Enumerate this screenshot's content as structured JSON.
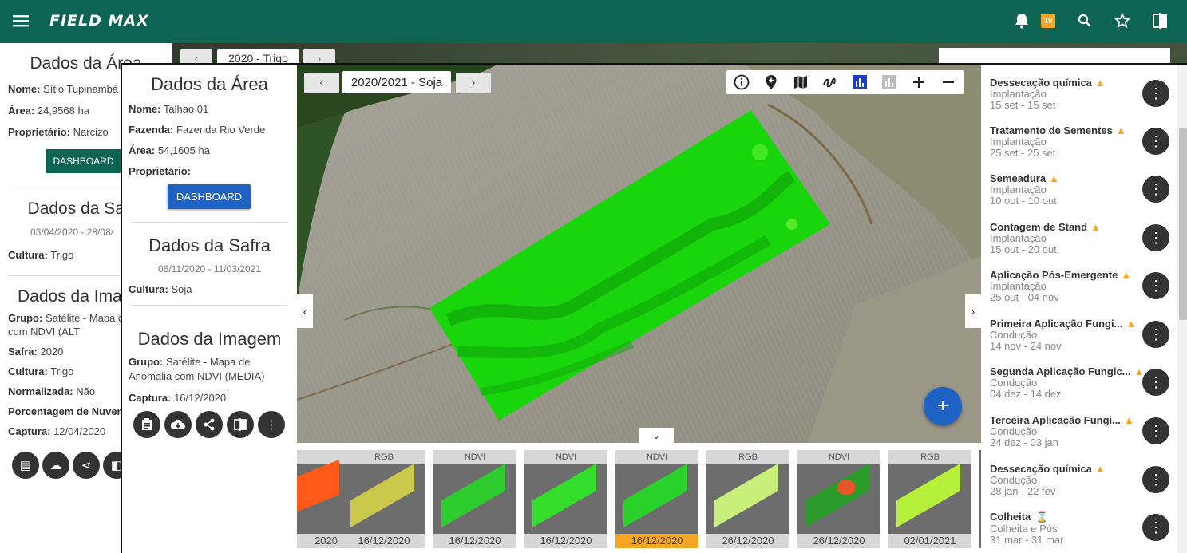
{
  "app": {
    "brand": "FIELD MAX",
    "notifications_count": "19"
  },
  "back_window": {
    "area": {
      "title": "Dados da Área",
      "nome_label": "Nome:",
      "nome": "Sítio Tupinambá",
      "area_label": "Área:",
      "area": "24,9568 ha",
      "proprietario_label": "Proprietário:",
      "proprietario": "Narcizo",
      "dashboard": "DASHBOARD"
    },
    "safra": {
      "title": "Dados da Safra",
      "dates": "03/04/2020 - 28/08/",
      "cultura_label": "Cultura:",
      "cultura": "Trigo"
    },
    "imagem": {
      "title": "Dados da Imagem",
      "grupo_label": "Grupo:",
      "grupo": "Satélite - Mapa d Anomalia com NDVI (ALT",
      "safra_label": "Safra:",
      "safra": "2020",
      "cultura_label": "Cultura:",
      "cultura": "Trigo",
      "normalizada_label": "Normalizada:",
      "normalizada": "Não",
      "porcentagem_label": "Porcentagem de Nuvem",
      "captura_label": "Captura:",
      "captura": "12/04/2020"
    },
    "season": "2020 - Trigo"
  },
  "front_window": {
    "area": {
      "title": "Dados da Área",
      "nome_label": "Nome:",
      "nome": "Talhao 01",
      "fazenda_label": "Fazenda:",
      "fazenda": "Fazenda Rio Verde",
      "area_label": "Área:",
      "area": "54,1605 ha",
      "proprietario_label": "Proprietário:",
      "dashboard": "DASHBOARD"
    },
    "safra": {
      "title": "Dados da Safra",
      "dates": "06/11/2020 - 11/03/2021",
      "cultura_label": "Cultura:",
      "cultura": "Soja"
    },
    "imagem": {
      "title": "Dados da Imagem",
      "grupo_label": "Grupo:",
      "grupo": "Satélite - Mapa de Anomalia com NDVI (MEDIA)",
      "captura_label": "Captura:",
      "captura": "16/12/2020"
    },
    "season": "2020/2021 - Soja",
    "thumbnails": [
      {
        "type": "",
        "date": "2020",
        "color": "#ff5a1a"
      },
      {
        "type": "RGB",
        "date": "16/12/2020",
        "color": "#c9c84a"
      },
      {
        "type": "NDVI",
        "date": "16/12/2020",
        "color": "#2ecb2e"
      },
      {
        "type": "NDVI",
        "date": "16/12/2020",
        "color": "#33dd2a"
      },
      {
        "type": "NDVI",
        "date": "16/12/2020",
        "color": "#2bd12b"
      },
      {
        "type": "RGB",
        "date": "26/12/2020",
        "color": "#c7ef7a"
      },
      {
        "type": "NDVI",
        "date": "26/12/2020",
        "color": "#2a9a2a"
      },
      {
        "type": "RGB",
        "date": "02/01/2021",
        "color": "#b7f03a"
      }
    ],
    "tasks": [
      {
        "title": "Dessecação química",
        "phase": "Implantação",
        "range": "15 set - 15 set",
        "icon": "warning"
      },
      {
        "title": "Tratamento de Sementes",
        "phase": "Implantação",
        "range": "25 set - 25 set",
        "icon": "warning"
      },
      {
        "title": "Semeadura",
        "phase": "Implantação",
        "range": "10 out - 10 out",
        "icon": "warning"
      },
      {
        "title": "Contagem de Stand",
        "phase": "Implantação",
        "range": "15 out - 20 out",
        "icon": "warning"
      },
      {
        "title": "Aplicação Pós-Emergente",
        "phase": "Implantação",
        "range": "25 out - 04 nov",
        "icon": "warning"
      },
      {
        "title": "Primeira Aplicação Fungi...",
        "phase": "Condução",
        "range": "14 nov - 24 nov",
        "icon": "warning"
      },
      {
        "title": "Segunda Aplicação Fungic...",
        "phase": "Condução",
        "range": "04 dez - 14 dez",
        "icon": "warning"
      },
      {
        "title": "Terceira Aplicação Fungi...",
        "phase": "Condução",
        "range": "24 dez - 03 jan",
        "icon": "warning"
      },
      {
        "title": "Dessecação química",
        "phase": "Condução",
        "range": "28 jan - 22 fev",
        "icon": "warning"
      },
      {
        "title": "Colheita",
        "phase": "Colheita e Pós",
        "range": "31 mar - 31 mar",
        "icon": "hourglass"
      }
    ]
  },
  "colors": {
    "header": "#0e6452",
    "accent_blue": "#1e63c4",
    "warning": "#f5a623",
    "selected_date": "#f5a623"
  }
}
